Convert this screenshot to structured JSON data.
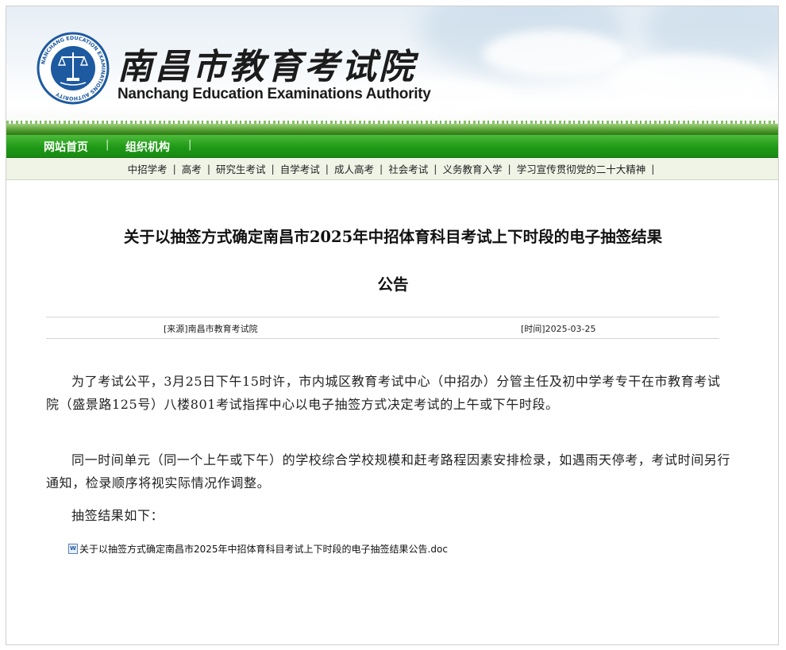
{
  "header": {
    "title_cn": "南昌市教育考试院",
    "title_en": "Nanchang Education Examinations Authority",
    "logo": {
      "icon": "scales-seal-icon",
      "text": "NANCHANG EDUCATION EXAMINATIONS AUTHORITY"
    }
  },
  "nav_main": {
    "items": [
      {
        "label": "网站首页"
      },
      {
        "label": "组织机构"
      }
    ],
    "separator": "|"
  },
  "nav_sub": {
    "items": [
      {
        "label": "中招学考"
      },
      {
        "label": "高考"
      },
      {
        "label": "研究生考试"
      },
      {
        "label": "自学考试"
      },
      {
        "label": "成人高考"
      },
      {
        "label": "社会考试"
      },
      {
        "label": "义务教育入学"
      },
      {
        "label": "学习宣传贯彻党的二十大精神"
      }
    ],
    "separator": "|"
  },
  "article": {
    "title_line1": "关于以抽签方式确定南昌市2025年中招体育科目考试上下时段的电子抽签结果",
    "title_line2": "公告",
    "source": "[来源]南昌市教育考试院",
    "time": "[时间]2025-03-25",
    "paragraphs": [
      "为了考试公平，3月25日下午15时许，市内城区教育考试中心（中招办）分管主任及初中学考专干在市教育考试院（盛景路125号）八楼801考试指挥中心以电子抽签方式决定考试的上午或下午时段。",
      "同一时间单元（同一个上午或下午）的学校综合学校规模和赶考路程因素安排检录，如遇雨天停考，考试时间另行通知，检录顺序将视实际情况作调整。",
      "抽签结果如下："
    ],
    "attachment": {
      "icon": "word-doc-icon",
      "label": "关于以抽签方式确定南昌市2025年中招体育科目考试上下时段的电子抽签结果公告.doc"
    }
  },
  "colors": {
    "nav_green": "#1f9a17",
    "sub_nav_bg": "#eff4e6",
    "seal_blue": "#1d5aa0"
  }
}
